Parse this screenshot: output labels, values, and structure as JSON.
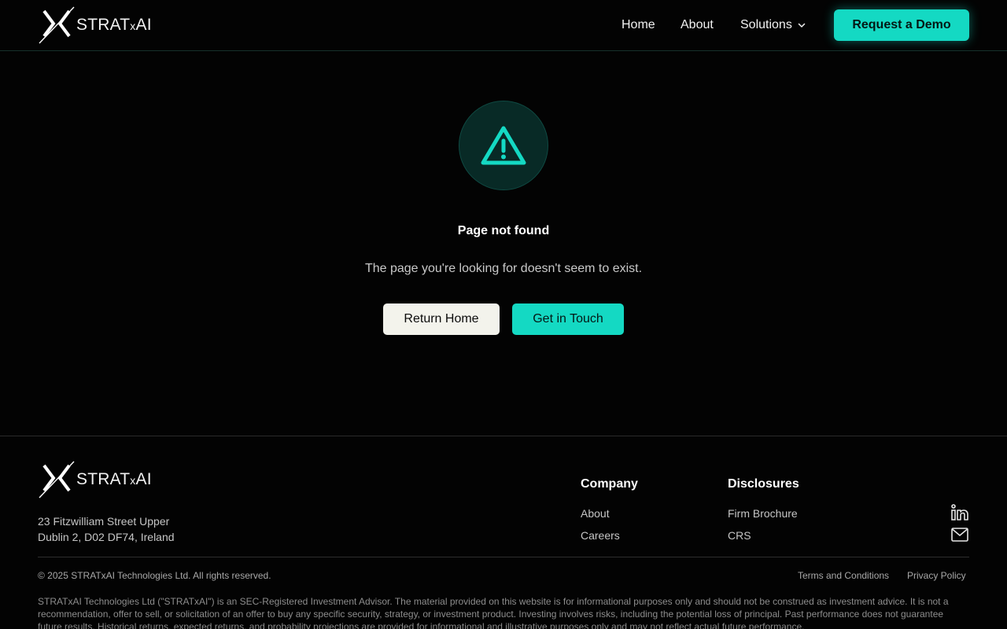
{
  "brand": {
    "name_main": "STRAT",
    "name_x": "x",
    "name_end": "AI",
    "accent_color": "#14d9c3"
  },
  "header": {
    "nav": [
      {
        "label": "Home"
      },
      {
        "label": "About"
      },
      {
        "label": "Solutions",
        "icon": "chevron-down-icon"
      }
    ],
    "cta_label": "Request a Demo"
  },
  "error": {
    "icon": "warning-triangle-icon",
    "title": "Page not found",
    "message": "The page you're looking for doesn't seem to exist.",
    "primary_button": "Return Home",
    "secondary_button": "Get in Touch"
  },
  "footer": {
    "address_line1": "23 Fitzwilliam Street Upper",
    "address_line2": "Dublin 2, D02 DF74, Ireland",
    "columns": [
      {
        "heading": "Company",
        "links": [
          "About",
          "Careers"
        ]
      },
      {
        "heading": "Disclosures",
        "links": [
          "Firm Brochure",
          "CRS"
        ]
      }
    ],
    "social": [
      "linkedin-icon",
      "mail-icon"
    ],
    "copyright": "© 2025 STRATxAI Technologies Ltd. All rights reserved.",
    "legal_links": [
      "Terms and Conditions",
      "Privacy Policy"
    ],
    "disclaimer": "STRATxAI Technologies Ltd (\"STRATxAI\") is an SEC-Registered Investment Advisor. The material provided on this website is for informational purposes only and should not be construed as investment advice. It is not a recommendation, offer to sell, or solicitation of an offer to buy any specific security, strategy, or investment product. Investing involves risks, including the potential loss of principal. Past performance does not guarantee future results. Historical returns, expected returns, and probability projections are provided for informational and illustrative purposes only and may not reflect actual future performance."
  }
}
